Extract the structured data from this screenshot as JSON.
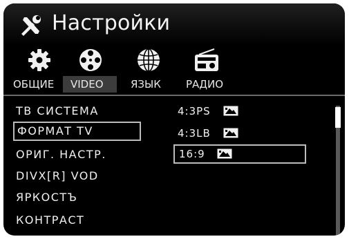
{
  "header": {
    "title": "Настройки",
    "icon": "tools-icon"
  },
  "tabs": [
    {
      "label": "ОБЩИЕ",
      "icon": "gear-icon",
      "active": false
    },
    {
      "label": "VIDEO",
      "icon": "film-reel-icon",
      "active": true
    },
    {
      "label": "ЯЗЫК",
      "icon": "globe-icon",
      "active": false
    },
    {
      "label": "РАДИО",
      "icon": "radio-icon",
      "active": false
    }
  ],
  "menu": {
    "items": [
      {
        "label": "ТВ СИСТЕМА",
        "selected": false
      },
      {
        "label": "ФОРМАТ TV",
        "selected": true
      },
      {
        "label": "ОРИГ. НАСТР.",
        "selected": false
      },
      {
        "label": "DIVX[R] VOD",
        "selected": false
      },
      {
        "label": "ЯРКОСТЪ",
        "selected": false
      },
      {
        "label": "КОНТРАСТ",
        "selected": false
      }
    ]
  },
  "options": {
    "items": [
      {
        "label": "4:3PS",
        "icon": "aspect-ratio-icon",
        "selected": false
      },
      {
        "label": "4:3LB",
        "icon": "aspect-ratio-icon",
        "selected": false
      },
      {
        "label": "16:9",
        "icon": "aspect-ratio-icon",
        "selected": true
      }
    ]
  },
  "scrollbar": {
    "position": 0
  },
  "colors": {
    "background": "#000000",
    "text": "#f0f0f0",
    "selection_border": "#bdbdbd",
    "active_tab": "#3c3c3c"
  }
}
